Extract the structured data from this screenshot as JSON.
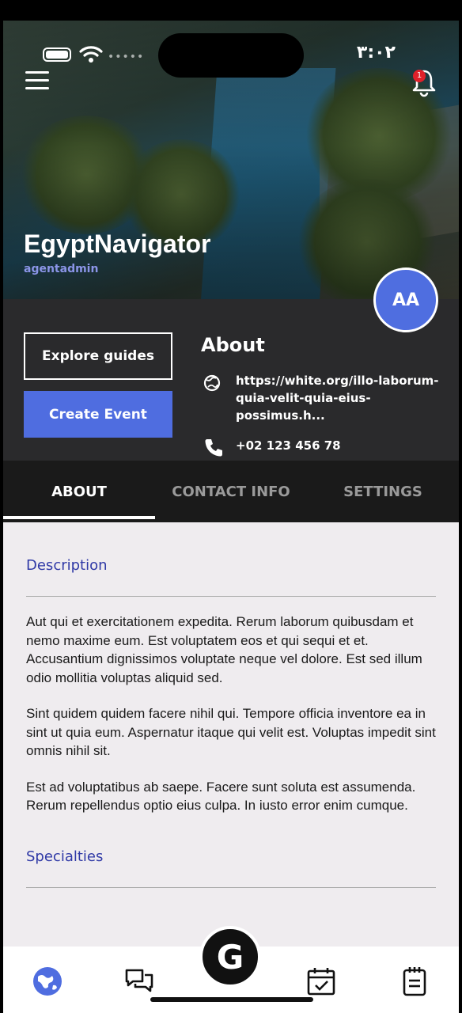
{
  "status": {
    "time": "٣:٠٢"
  },
  "header": {
    "notification_count": "1",
    "site_name": "EgyptNavigator",
    "username": "agentadmin",
    "avatar_initials": "AA"
  },
  "actions": {
    "explore_label": "Explore guides",
    "create_label": "Create Event"
  },
  "about": {
    "heading": "About",
    "website": "https://white.org/illo-laborum-quia-velit-quia-eius-possimus.h...",
    "phone": "+02 123 456 78"
  },
  "tabs": [
    {
      "label": "ABOUT",
      "active": true
    },
    {
      "label": "CONTACT INFO",
      "active": false
    },
    {
      "label": "SETTINGS",
      "active": false
    }
  ],
  "content": {
    "description_heading": "Description",
    "paragraphs": [
      "Aut qui et exercitationem expedita. Rerum laborum quibusdam et nemo maxime eum. Est voluptatem eos et qui sequi et et. Accusantium dignissimos voluptate neque vel dolore. Est sed illum odio mollitia voluptas aliquid sed.",
      "Sint quidem quidem facere nihil qui. Tempore officia inventore ea in sint ut quia eum. Aspernatur itaque qui velit est. Voluptas impedit sint omnis nihil sit.",
      "Est ad voluptatibus ab saepe. Facere sunt soluta est assumenda. Rerum repellendus optio eius culpa. In iusto error enim cumque."
    ],
    "specialties_heading": "Specialties"
  },
  "bottom_nav": {
    "center_label": "G",
    "icons": [
      "globe-icon",
      "chat-icon",
      "calendar-check-icon",
      "notes-icon"
    ]
  },
  "colors": {
    "accent": "#4f6de0",
    "heading_blue": "#2f39a6",
    "band": "#2a2a2c",
    "tabs_bg": "#1a1a1a"
  }
}
